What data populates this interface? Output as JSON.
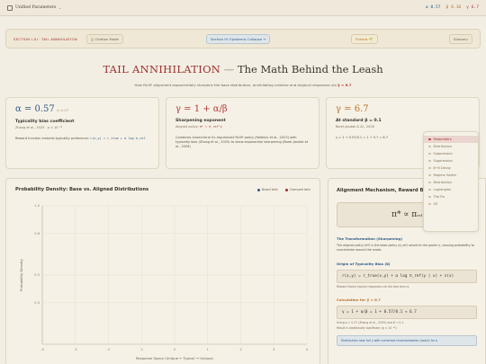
{
  "topbar": {
    "title": "Unified Parameters",
    "alpha": "α 0.57",
    "beta": "β 0.10",
    "gamma": "γ 6.7"
  },
  "secbar": {
    "section": "SECTION I–III · TAIL ANNIHILATION",
    "citation_label": "Citation Mode",
    "next_label": "Section IV: Epistemic Collapse →",
    "friends_label": "Friends 🌱",
    "glossary_label": "Glossary"
  },
  "heading": {
    "highlight": "TAIL ANNIHILATION",
    "dash": " — ",
    "rest": "The Math Behind the Leash"
  },
  "subheading": {
    "text": "How RLHF alignment exponentially sharpens the base distribution, annihilating creative and atypical responses via ",
    "gamma": "γ ≈ 6.7"
  },
  "cards": [
    {
      "big": "α = 0.57",
      "big_note": "± 0.07",
      "label": "Typicality bias coefficient",
      "sub": "Zhang et al., 2025 · p < 10⁻¹⁴",
      "body": "Reward function embeds typicality preference: ",
      "formula": "r(x,y) = r_true + α log π_ref"
    },
    {
      "big": "γ = 1 + α/β",
      "big_note": "",
      "label": "Sharpening exponent",
      "sub": "Aligned policy: ",
      "sub_formula": "π* ∝ π_ref^γ",
      "body": "Combines closed-form KL-regularized RLHF policy (Rafailov et al., 2023) with typicality bias (Zhang et al., 2025) to show exponential sharpening (Borel-Jandak et al., 2026)",
      "formula": ""
    },
    {
      "big": "γ = 6.7",
      "big_note": "",
      "label": "At standard β = 0.1",
      "sub": "Borel-Jandak & Al., 2026",
      "body": "",
      "formula": "γ = 1 + 0.57/0.1 = 1 + 5.7 = 6.7"
    }
  ],
  "chart_panel": {
    "title": "Probability Density: Base vs. Aligned Distributions",
    "legend_base": "Broad tails",
    "legend_aligned": "Clamped tails"
  },
  "chart_data": {
    "type": "line",
    "title": "Probability Density: Base vs. Aligned Distributions",
    "xlabel": "Response Space (Unique ← Typical → Unique)",
    "ylabel": "Probability Density",
    "x_ticks": [
      "-4",
      "-3",
      "-2",
      "-1",
      "0",
      "1",
      "2",
      "3",
      "4"
    ],
    "y_ticks": [
      "1.0",
      "0.8",
      "0.5",
      "0.3"
    ],
    "xlim": [
      -4,
      4
    ],
    "ylim": [
      0,
      1.0
    ],
    "grid": true,
    "series": [
      {
        "name": "Broad tails",
        "values": []
      },
      {
        "name": "Clamped tails",
        "values": []
      }
    ]
  },
  "mechanism": {
    "title": "Alignment Mechanism, Reward Bias",
    "formula": "π* ∝ π",
    "formula_sub": "ref",
    "h1": "The Transformation (Sharpening)",
    "p1": "The aligned policy (π*) is the base policy (π_ref) raised to the power γ, causing probability to concentrate around the mode.",
    "h2": "Origin of Typicality Bias (α)",
    "eq2": "r(x,y) = r_true(x,y) + α log π_ref(y | x) + ε(x)",
    "note2": "Reward favors typical responses via the bias term α.",
    "h3": "Calculation for γ ≈ 6.7",
    "eq3": "γ = 1 + α/β = 1 + 0.57/0.1 ≈ 6.7",
    "note3a": "Using α = 0.57 (Zhang et al., 2025) and β = 0.1.",
    "note3b": "Result is statistically significant (p < 10⁻¹⁴).",
    "blue_note": "Distribution near full γ with numerical renormalization (exact) for a"
  },
  "nav": [
    {
      "label": "Parameters",
      "active": true
    },
    {
      "label": "Distribution",
      "active": false
    },
    {
      "label": "Suppression",
      "active": false
    },
    {
      "label": "Suppression",
      "active": false
    },
    {
      "label": "β→0 Decay",
      "active": false
    },
    {
      "label": "Regime Switch",
      "active": false
    },
    {
      "label": "Distribution",
      "active": false
    },
    {
      "label": "Lagrangian",
      "active": false
    },
    {
      "label": "The Fix",
      "active": false
    },
    {
      "label": "VS",
      "active": false
    }
  ]
}
